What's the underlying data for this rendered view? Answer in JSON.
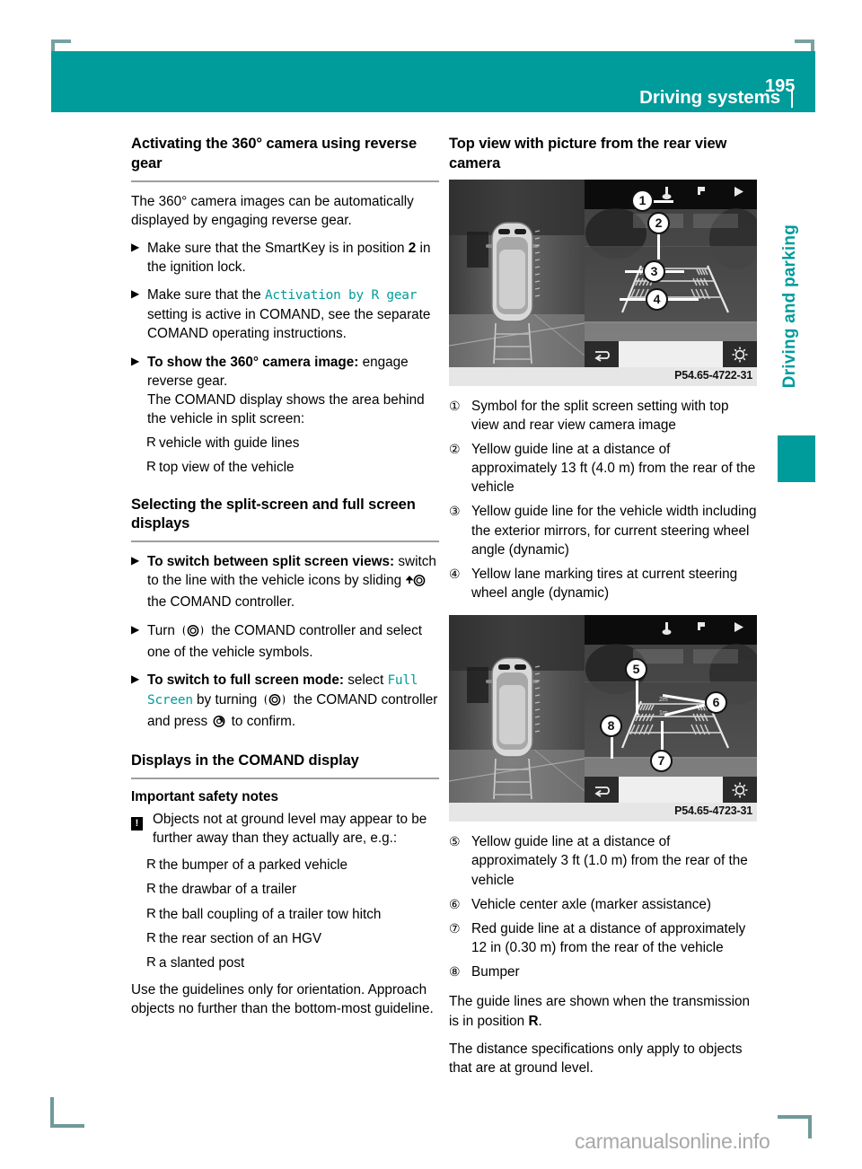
{
  "header": {
    "title": "Driving systems",
    "page_number": "195",
    "accent_color": "#009b9b"
  },
  "side_tab": {
    "label": "Driving and parking"
  },
  "left_column": {
    "heading_1": "Activating the 360° camera using reverse gear",
    "intro": "The 360° camera images can be automatically displayed by engaging reverse gear.",
    "step_1_a": "Make sure that the SmartKey is in position ",
    "step_1_bold": "2",
    "step_1_b": " in the ignition lock.",
    "step_2_a": "Make sure that the ",
    "step_2_code": "Activation by R gear",
    "step_2_b": " setting is active in COMAND, see the separate COMAND operating instructions.",
    "step_3_bold": "To show the 360° camera image:",
    "step_3_rest": " engage reverse gear.",
    "step_3_cont": "The COMAND display shows the area behind the vehicle in split screen:",
    "bullet_1": "vehicle with guide lines",
    "bullet_2": "top view of the vehicle",
    "heading_2": "Selecting the split-screen and full screen displays",
    "step_4_bold": "To switch between split screen views:",
    "step_4_rest_a": " switch to the line with the vehicle icons by sliding ",
    "step_4_rest_b": " the COMAND controller.",
    "step_5_a": "Turn ",
    "step_5_b": " the COMAND controller and select one of the vehicle symbols.",
    "step_6_bold": "To switch to full screen mode:",
    "step_6_a": " select ",
    "step_6_code": "Full Screen",
    "step_6_b": " by turning ",
    "step_6_c": " the COMAND controller and press ",
    "step_6_d": " to confirm.",
    "heading_3": "Displays in the COMAND display",
    "subheading_1": "Important safety notes",
    "warning_icon": "warning-exclamation-icon",
    "warning_text": "Objects not at ground level may appear to be further away than they actually are, e.g.:",
    "warn_bullets": [
      "the bumper of a parked vehicle",
      "the drawbar of a trailer",
      "the ball coupling of a trailer tow hitch",
      "the rear section of an HGV",
      "a slanted post"
    ],
    "closing": "Use the guidelines only for orientation. Approach objects no further than the bottom-most guideline."
  },
  "right_column": {
    "heading_1": "Top view with picture from the rear view camera",
    "figure_1": {
      "caption": "P54.65-4722-31",
      "callouts": [
        "1",
        "2",
        "3",
        "4"
      ],
      "screen_labels": {
        "back_icon": "back-arrow-icon",
        "brightness_icon": "brightness-sun-icon",
        "next_icon": "play-triangle-icon"
      }
    },
    "figure_2": {
      "caption": "P54.65-4723-31",
      "callouts": [
        "5",
        "6",
        "7",
        "8"
      ],
      "distance_labels": [
        "2m",
        "1m"
      ],
      "screen_labels": {
        "back_icon": "back-arrow-icon",
        "brightness_icon": "brightness-sun-icon",
        "next_icon": "play-triangle-icon"
      }
    },
    "list_1": [
      {
        "num": "1",
        "text": "Symbol for the split screen setting with top view and rear view camera image"
      },
      {
        "num": "2",
        "text": "Yellow guide line at a distance of approximately 13 ft (4.0 m) from the rear of the vehicle"
      },
      {
        "num": "3",
        "text": "Yellow guide line for the vehicle width including the exterior mirrors, for current steering wheel angle (dynamic)"
      },
      {
        "num": "4",
        "text": "Yellow lane marking tires at current steering wheel angle (dynamic)"
      }
    ],
    "list_2": [
      {
        "num": "5",
        "text": "Yellow guide line at a distance of approximately 3 ft (1.0 m) from the rear of the vehicle"
      },
      {
        "num": "6",
        "text": "Vehicle center axle (marker assistance)"
      },
      {
        "num": "7",
        "text": "Red guide line at a distance of approximately 12 in (0.30 m) from the rear of the vehicle"
      },
      {
        "num": "8",
        "text": "Bumper"
      }
    ],
    "closing_1_a": "The guide lines are shown when the transmission is in position ",
    "closing_1_bold": "R",
    "closing_1_b": ".",
    "closing_2": "The distance specifications only apply to objects that are at ground level."
  },
  "watermark": "carmanualsonline.info"
}
